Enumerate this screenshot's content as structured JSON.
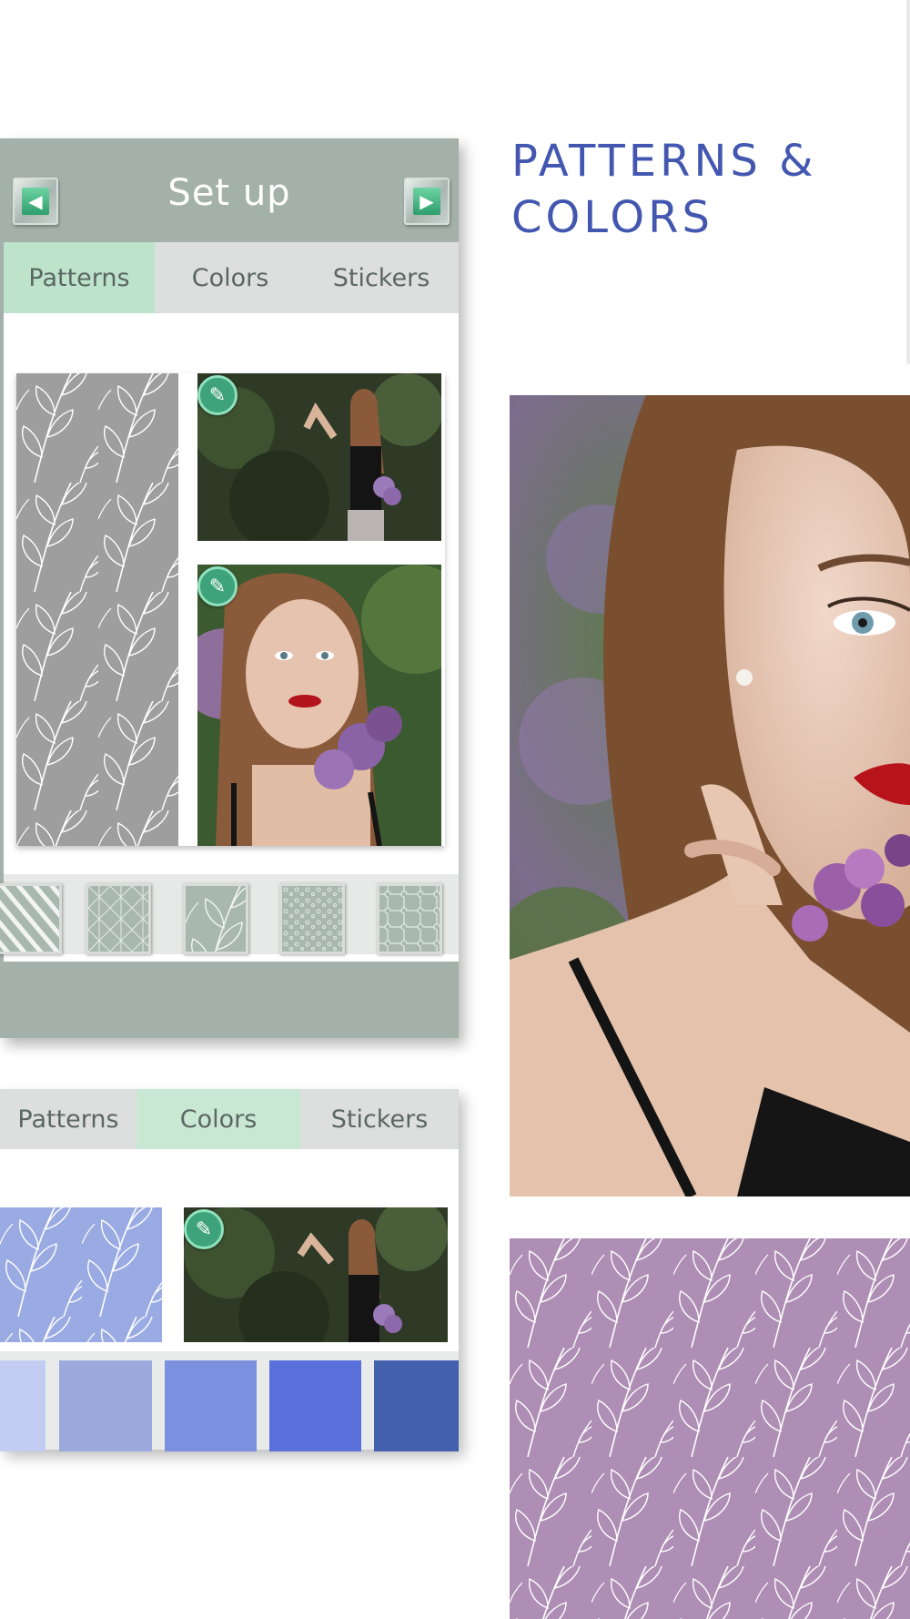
{
  "headline": {
    "line1": "PATTERNS &",
    "line2": "COLORS"
  },
  "panel1": {
    "title": "Set up",
    "prev_icon": "arrow-left-icon",
    "next_icon": "arrow-right-icon",
    "tabs": [
      "Patterns",
      "Colors",
      "Stickers"
    ],
    "active_tab": "Patterns",
    "edit_icon": "pencil-icon",
    "thumbnails": [
      "stripes-pattern",
      "geometric-pattern",
      "leaf-pattern",
      "floral-pattern",
      "puzzle-pattern"
    ]
  },
  "panel2": {
    "tabs": [
      "Patterns",
      "Colors",
      "Stickers"
    ],
    "active_tab": "Colors",
    "swatches": [
      "#c3cdf4",
      "#9ba9dd",
      "#7b90de",
      "#5a71dc",
      "#4360ad"
    ]
  },
  "colors": {
    "headline": "#4457b0",
    "panel_bg": "#a4b1aa",
    "active_tab_1": "#bde3cb",
    "active_tab_2": "#c9e8d3",
    "pattern_gray": "#9e9e9e",
    "pattern_blue": "#9aabe3",
    "pattern_purple": "#af8eb5"
  }
}
